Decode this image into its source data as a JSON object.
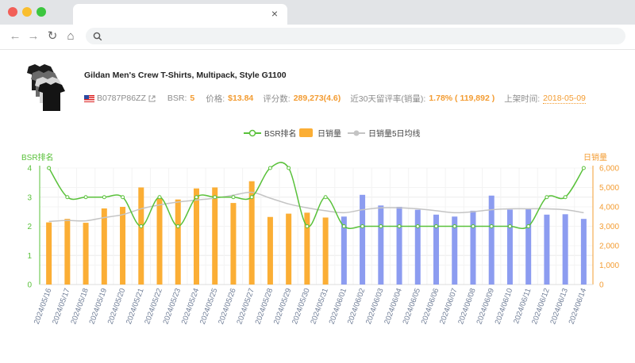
{
  "browser": {
    "tab_close": "×",
    "back_icon": "←",
    "forward_icon": "→",
    "reload_icon": "↻",
    "home_icon": "⌂",
    "address_value": ""
  },
  "product": {
    "title": "Gildan Men's Crew T-Shirts, Multipack, Style G1100",
    "asin": "B0787P86ZZ",
    "bsr_label": "BSR:",
    "bsr_value": "5",
    "price_label": "价格:",
    "price_value": "$13.84",
    "reviews_label": "评分数:",
    "reviews_value": "289,273(4.6)",
    "retention_label": "近30天留评率(销量):",
    "retention_value": "1.78% ( 119,892 )",
    "listed_label": "上架时间:",
    "listed_value": "2018-05-09"
  },
  "colors": {
    "bsr_line": "#59c13a",
    "bar_past": "#fbae35",
    "bar_recent": "#8c9cf0",
    "avg_line": "#c4c4c4",
    "accent_orange": "#f39c32"
  },
  "chart_data": {
    "type": "bar",
    "legend": [
      "BSR排名",
      "日销量",
      "日销量5日均线"
    ],
    "legend_position": "top-center",
    "y_left_label": "BSR排名",
    "y_right_label": "日销量",
    "y_left_range": [
      0,
      4
    ],
    "y_left_ticks": [
      "0",
      "1",
      "2",
      "3",
      "4"
    ],
    "y_right_range": [
      0,
      6000
    ],
    "y_right_ticks": [
      "0",
      "1,000",
      "2,000",
      "3,000",
      "4,000",
      "5,000",
      "6,000"
    ],
    "categories": [
      "2024/05/16",
      "2024/05/17",
      "2024/05/18",
      "2024/05/19",
      "2024/05/20",
      "2024/05/21",
      "2024/05/22",
      "2024/05/23",
      "2024/05/24",
      "2024/05/25",
      "2024/05/26",
      "2024/05/27",
      "2024/05/28",
      "2024/05/29",
      "2024/05/30",
      "2024/05/31",
      "2024/06/01",
      "2024/06/02",
      "2024/06/03",
      "2024/06/04",
      "2024/06/05",
      "2024/06/06",
      "2024/06/07",
      "2024/06/08",
      "2024/06/09",
      "2024/06/10",
      "2024/06/11",
      "2024/06/12",
      "2024/06/13",
      "2024/06/14"
    ],
    "series": [
      {
        "name": "日销量",
        "values": [
          3200,
          3380,
          3180,
          3920,
          4000,
          5000,
          4450,
          4380,
          4950,
          5000,
          4200,
          5320,
          3480,
          3650,
          3700,
          3450,
          3500,
          4620,
          4070,
          4000,
          3850,
          3600,
          3500,
          3800,
          4580,
          3860,
          3900,
          3600,
          3620,
          3380
        ]
      },
      {
        "name": "BSR排名",
        "values": [
          4,
          3,
          3,
          3,
          3,
          2,
          3,
          2,
          3,
          3,
          3,
          3,
          4,
          4,
          2,
          3,
          2,
          2,
          2,
          2,
          2,
          2,
          2,
          2,
          2,
          2,
          2,
          3,
          3,
          4
        ]
      },
      {
        "name": "日销量5日均线",
        "values": [
          3250,
          3300,
          3280,
          3450,
          3600,
          3900,
          4100,
          4250,
          4350,
          4450,
          4600,
          4750,
          4450,
          4150,
          3950,
          3800,
          3700,
          3850,
          3950,
          3950,
          3900,
          3800,
          3700,
          3750,
          3850,
          3900,
          3900,
          3900,
          3850,
          3700
        ]
      }
    ],
    "recent_from_index": 16,
    "grid": true
  }
}
